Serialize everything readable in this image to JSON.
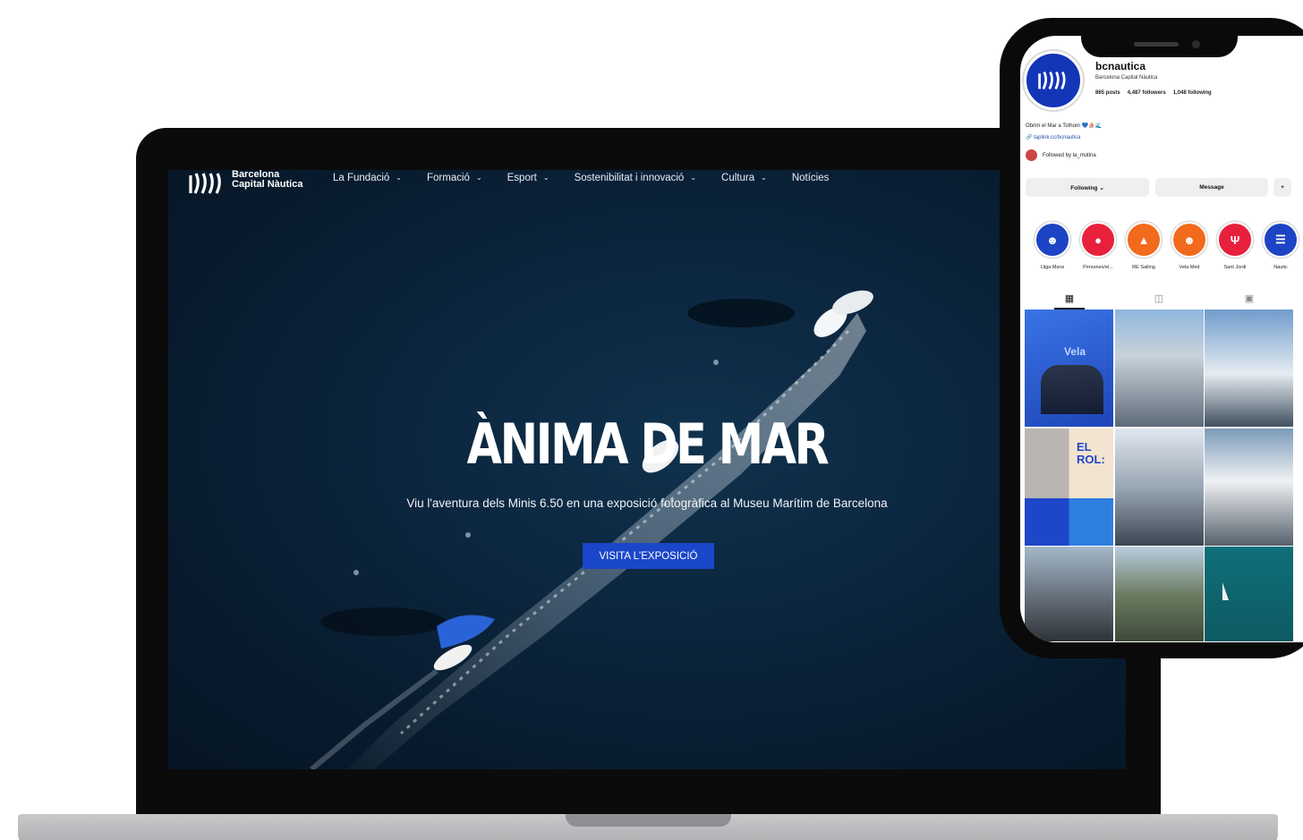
{
  "website": {
    "brand": {
      "line1": "Barcelona",
      "line2": "Capital Nàutica"
    },
    "nav": [
      {
        "label": "La Fundació",
        "has_dropdown": true
      },
      {
        "label": "Formació",
        "has_dropdown": true
      },
      {
        "label": "Esport",
        "has_dropdown": true
      },
      {
        "label": "Sostenibilitat i innovació",
        "has_dropdown": true
      },
      {
        "label": "Cultura",
        "has_dropdown": true
      },
      {
        "label": "Notícies",
        "has_dropdown": false
      }
    ],
    "hero": {
      "title": "ÀNIMA DE MAR",
      "subtitle": "Viu l'aventura dels Minis 6.50 en una exposició fotogràfica al Museu Marítim de Barcelona",
      "cta": "VISITA L'EXPOSICIÓ"
    },
    "colors": {
      "cta": "#1a46c9",
      "sea": "#0c2740"
    }
  },
  "instagram": {
    "handle": "bcnautica",
    "full_name": "Barcelona Capital Nàutica",
    "stats": {
      "posts": "865 posts",
      "followers": "4,487 followers",
      "following": "1,048 following"
    },
    "bio": "Obrim el Mar a Tothom 💙⛵🌊",
    "link": "taplink.cc/bcnautica",
    "followed_by": "Followed by la_mutina",
    "buttons": {
      "following": "Following ⌄",
      "message": "Message",
      "add": "+"
    },
    "highlights": [
      {
        "label": "Lliga Mans",
        "color": "#1d44c4",
        "icon": "people-icon"
      },
      {
        "label": "Persones/el...",
        "color": "#e8203c",
        "icon": "speaker-icon"
      },
      {
        "label": "RE Sailing",
        "color": "#f26a1b",
        "icon": "podium-icon"
      },
      {
        "label": "Vela Med",
        "color": "#f26a1b",
        "icon": "people-icon"
      },
      {
        "label": "Sant Jordi",
        "color": "#e8203c",
        "icon": "fork-icon"
      },
      {
        "label": "Nautic",
        "color": "#1d44c4",
        "icon": "glyph-icon"
      }
    ],
    "tabs": [
      "grid-icon",
      "reels-icon",
      "tagged-icon"
    ],
    "grid_tiles": [
      {
        "caption": "Vela"
      },
      {
        "caption": ""
      },
      {
        "caption": ""
      },
      {
        "caption": "EL ROL:"
      },
      {
        "caption": ""
      },
      {
        "caption": ""
      },
      {
        "caption": ""
      },
      {
        "caption": ""
      },
      {
        "caption": ""
      }
    ]
  }
}
